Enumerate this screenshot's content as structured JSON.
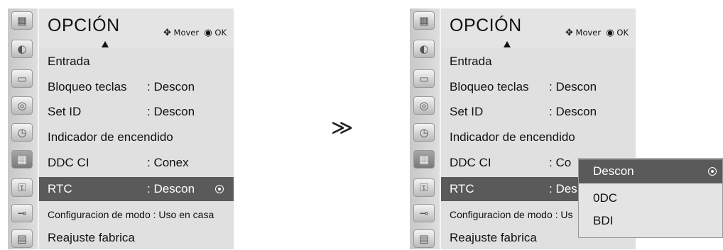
{
  "menu": {
    "title": "OPCIÓN",
    "hint_move_icon": "four-way-arrow-icon",
    "hint_move": "Mover",
    "hint_ok_icon": "ok-dot-icon",
    "hint_ok": "OK"
  },
  "icons": [
    "picture-icon",
    "screen-icon",
    "audio-icon",
    "time-icon",
    "option-icon",
    "lock-icon",
    "input-plug-icon",
    "usb-photo-icon"
  ],
  "items": [
    {
      "label": "Entrada",
      "value": ""
    },
    {
      "label": "Bloqueo teclas",
      "value": ": Descon"
    },
    {
      "label": "Set ID",
      "value": ": Descon"
    },
    {
      "label": "Indicador de encendido",
      "value": ""
    },
    {
      "label": "DDC CI",
      "value": ": Conex"
    },
    {
      "label": "RTC",
      "value": ": Descon"
    },
    {
      "label": "Configuracion de modo : Uso en casa",
      "value": ""
    },
    {
      "label": "Reajuste fabrica",
      "value": ""
    }
  ],
  "selected_index": 5,
  "right_item_values": [
    "",
    ": Descon",
    ": Descon",
    "",
    ": Co",
    ": Des",
    "",
    ""
  ],
  "right_config_label": "Configuracion de modo : Us",
  "transition_arrow": "≫",
  "dropdown": {
    "options": [
      "Descon",
      "0DC",
      "BDI"
    ],
    "selected_index": 0
  },
  "colors": {
    "panel": "#e4e4e4",
    "highlight": "#5a5a5a",
    "highlight_text": "#ffffff"
  }
}
